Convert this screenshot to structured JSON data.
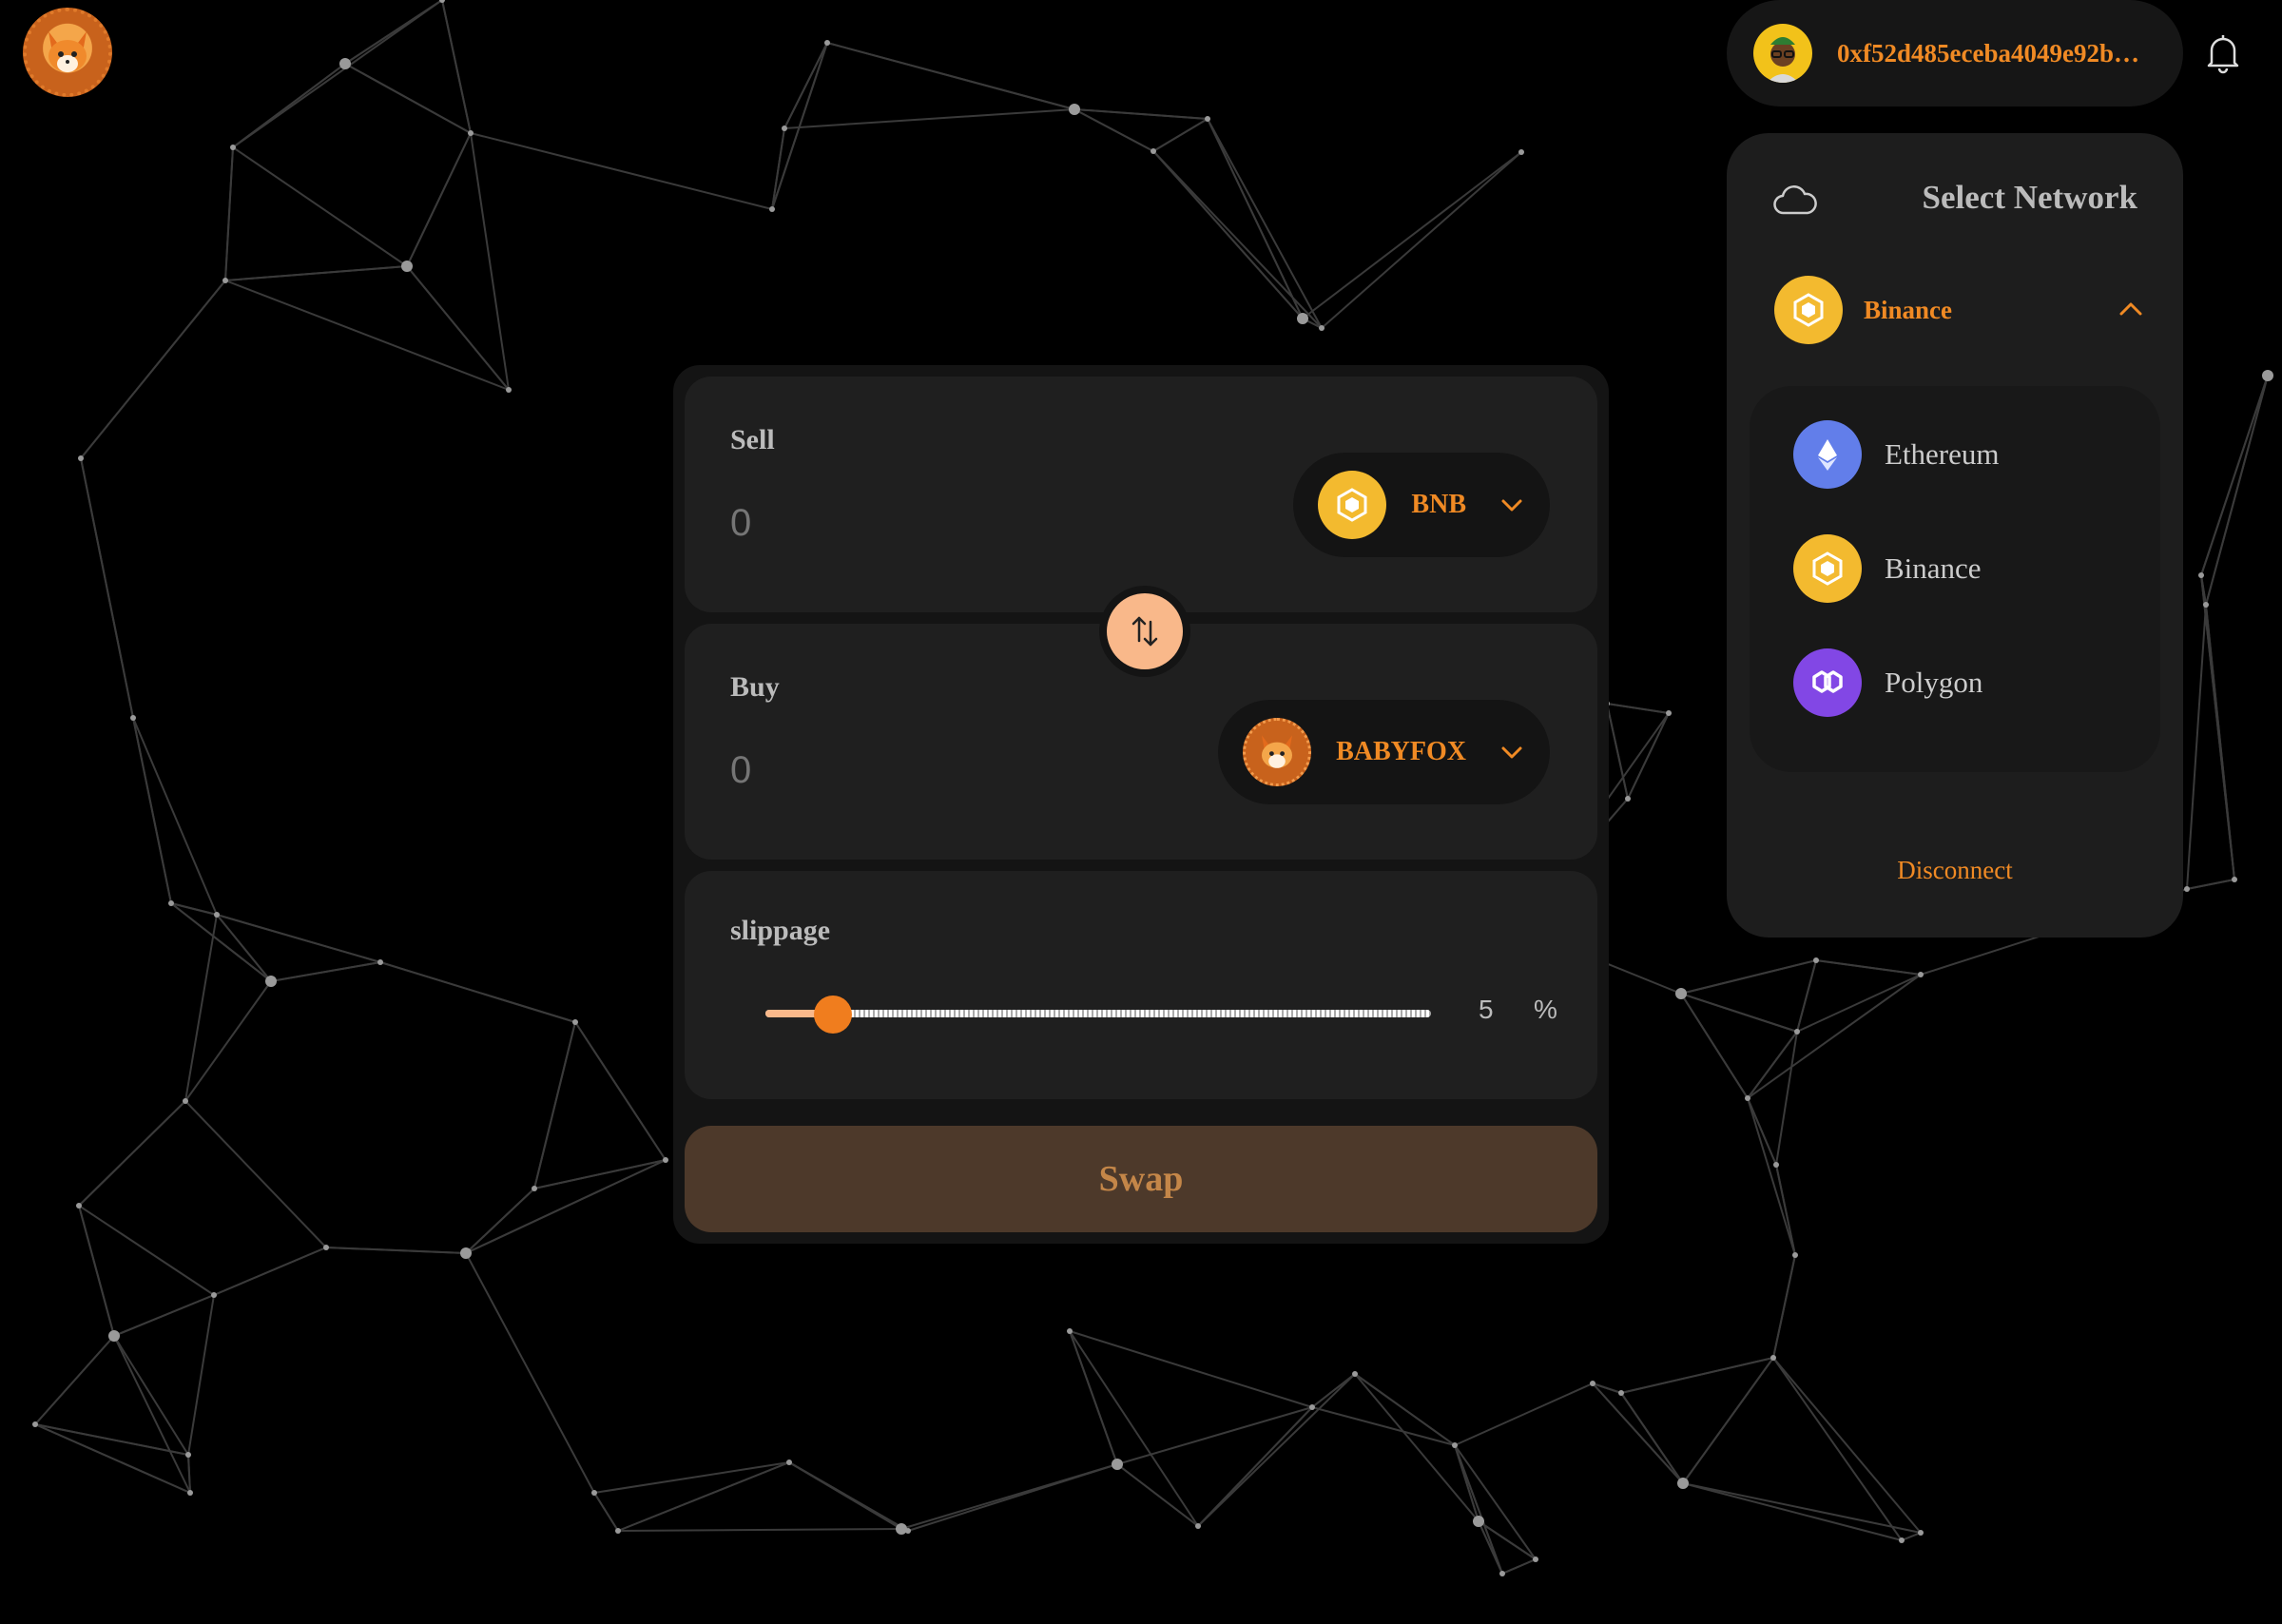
{
  "wallet": {
    "address": "0xf52d485eceba4049e92b…"
  },
  "network_panel": {
    "title": "Select Network",
    "selected": "Binance",
    "options": [
      {
        "label": "Ethereum",
        "icon": "ethereum-icon"
      },
      {
        "label": "Binance",
        "icon": "binance-icon"
      },
      {
        "label": "Polygon",
        "icon": "polygon-icon"
      }
    ],
    "disconnect_label": "Disconnect"
  },
  "swap": {
    "sell": {
      "label": "Sell",
      "amount_placeholder": "0",
      "token": "BNB"
    },
    "buy": {
      "label": "Buy",
      "amount_placeholder": "0",
      "token": "BABYFOX"
    },
    "slippage": {
      "label": "slippage",
      "value": "5",
      "unit": "%",
      "min": 0,
      "max": 100,
      "current": 5
    },
    "swap_label": "Swap"
  },
  "colors": {
    "accent": "#f08a24",
    "binance": "#f3ba2f",
    "ethereum": "#627eea",
    "polygon": "#8247e5",
    "swap_button_bg": "#4d392a",
    "flip_button": "#f9b88a"
  }
}
